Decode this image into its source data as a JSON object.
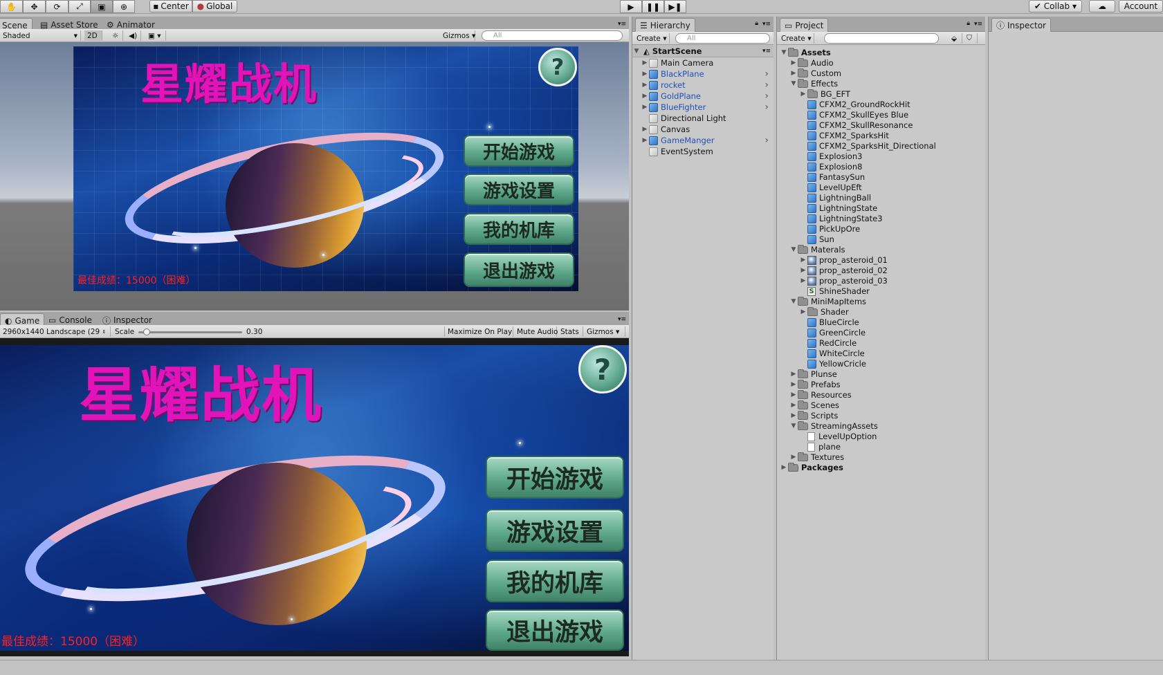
{
  "toolbar": {
    "pivot_label": "Center",
    "space_label": "Global",
    "collab_label": "Collab",
    "account_label": "Account",
    "tool_icons": [
      "hand-icon",
      "move-icon",
      "rotate-icon",
      "scale-icon",
      "rect-icon",
      "transform-icon"
    ]
  },
  "scene_view": {
    "tabs": [
      "Scene",
      "Asset Store",
      "Animator"
    ],
    "shading_mode": "Shaded",
    "mode_2d": "2D",
    "gizmos_label": "Gizmos",
    "search_placeholder": "All"
  },
  "game_view": {
    "tabs": [
      "Game",
      "Console",
      "Inspector"
    ],
    "resolution": "2960x1440 Landscape (29",
    "scale_label": "Scale",
    "scale_value": "0.30",
    "scale_fraction": 0.05,
    "buttons": [
      "Maximize On Play",
      "Mute Audio",
      "Stats",
      "Gizmos"
    ]
  },
  "game_ui": {
    "title": "星耀战机",
    "menu_buttons": [
      "开始游戏",
      "游戏设置",
      "我的机库",
      "退出游戏"
    ],
    "best_score": "最佳成绩：15000（困难）",
    "help_glyph": "?"
  },
  "hierarchy": {
    "tab": "Hierarchy",
    "create_label": "Create",
    "search_placeholder": "All",
    "scene_name": "StartScene",
    "items": [
      {
        "name": "Main Camera",
        "prefab": false,
        "expandable": true,
        "chevron": false
      },
      {
        "name": "BlackPlane",
        "prefab": true,
        "expandable": true,
        "chevron": true
      },
      {
        "name": "rocket",
        "prefab": true,
        "expandable": true,
        "chevron": true
      },
      {
        "name": "GoldPlane",
        "prefab": true,
        "expandable": true,
        "chevron": true
      },
      {
        "name": "BlueFighter",
        "prefab": true,
        "expandable": true,
        "chevron": true
      },
      {
        "name": "Directional Light",
        "prefab": false,
        "expandable": false,
        "chevron": false
      },
      {
        "name": "Canvas",
        "prefab": false,
        "expandable": true,
        "chevron": false
      },
      {
        "name": "GameManger",
        "prefab": true,
        "expandable": true,
        "chevron": true
      },
      {
        "name": "EventSystem",
        "prefab": false,
        "expandable": false,
        "chevron": false
      }
    ]
  },
  "project": {
    "tab": "Project",
    "create_label": "Create",
    "items": [
      {
        "name": "Assets",
        "depth": 0,
        "kind": "folder",
        "arrow": "open",
        "bold": true
      },
      {
        "name": "Audio",
        "depth": 1,
        "kind": "folder",
        "arrow": "closed"
      },
      {
        "name": "Custom",
        "depth": 1,
        "kind": "folder",
        "arrow": "closed"
      },
      {
        "name": "Effects",
        "depth": 1,
        "kind": "folder",
        "arrow": "open"
      },
      {
        "name": "BG_EFT",
        "depth": 2,
        "kind": "folder",
        "arrow": "closed"
      },
      {
        "name": "CFXM2_GroundRockHit",
        "depth": 2,
        "kind": "prefab",
        "arrow": "none"
      },
      {
        "name": "CFXM2_SkullEyes Blue",
        "depth": 2,
        "kind": "prefab",
        "arrow": "none"
      },
      {
        "name": "CFXM2_SkullResonance",
        "depth": 2,
        "kind": "prefab",
        "arrow": "none"
      },
      {
        "name": "CFXM2_SparksHit",
        "depth": 2,
        "kind": "prefab",
        "arrow": "none"
      },
      {
        "name": "CFXM2_SparksHit_Directional",
        "depth": 2,
        "kind": "prefab",
        "arrow": "none"
      },
      {
        "name": "Explosion3",
        "depth": 2,
        "kind": "prefab",
        "arrow": "none"
      },
      {
        "name": "Explosion8",
        "depth": 2,
        "kind": "prefab",
        "arrow": "none"
      },
      {
        "name": "FantasySun",
        "depth": 2,
        "kind": "prefab",
        "arrow": "none"
      },
      {
        "name": "LevelUpEft",
        "depth": 2,
        "kind": "prefab",
        "arrow": "none"
      },
      {
        "name": "LightningBall",
        "depth": 2,
        "kind": "prefab",
        "arrow": "none"
      },
      {
        "name": "LightningState",
        "depth": 2,
        "kind": "prefab",
        "arrow": "none"
      },
      {
        "name": "LightningState3",
        "depth": 2,
        "kind": "prefab",
        "arrow": "none"
      },
      {
        "name": "PickUpOre",
        "depth": 2,
        "kind": "prefab",
        "arrow": "none"
      },
      {
        "name": "Sun",
        "depth": 2,
        "kind": "prefab",
        "arrow": "none"
      },
      {
        "name": "Materals",
        "depth": 1,
        "kind": "folder",
        "arrow": "open"
      },
      {
        "name": "prop_asteroid_01",
        "depth": 2,
        "kind": "material",
        "arrow": "closed"
      },
      {
        "name": "prop_asteroid_02",
        "depth": 2,
        "kind": "material",
        "arrow": "closed"
      },
      {
        "name": "prop_asteroid_03",
        "depth": 2,
        "kind": "material",
        "arrow": "closed"
      },
      {
        "name": "ShineShader",
        "depth": 2,
        "kind": "shader",
        "arrow": "none"
      },
      {
        "name": "MiniMapItems",
        "depth": 1,
        "kind": "folder",
        "arrow": "open"
      },
      {
        "name": "Shader",
        "depth": 2,
        "kind": "folder",
        "arrow": "closed"
      },
      {
        "name": "BlueCircle",
        "depth": 2,
        "kind": "prefab",
        "arrow": "none"
      },
      {
        "name": "GreenCircle",
        "depth": 2,
        "kind": "prefab",
        "arrow": "none"
      },
      {
        "name": "RedCircle",
        "depth": 2,
        "kind": "prefab",
        "arrow": "none"
      },
      {
        "name": "WhiteCircle",
        "depth": 2,
        "kind": "prefab",
        "arrow": "none"
      },
      {
        "name": "YellowCricle",
        "depth": 2,
        "kind": "prefab",
        "arrow": "none"
      },
      {
        "name": "Plunse",
        "depth": 1,
        "kind": "folder",
        "arrow": "closed"
      },
      {
        "name": "Prefabs",
        "depth": 1,
        "kind": "folder",
        "arrow": "closed"
      },
      {
        "name": "Resources",
        "depth": 1,
        "kind": "folder",
        "arrow": "closed"
      },
      {
        "name": "Scenes",
        "depth": 1,
        "kind": "folder",
        "arrow": "closed"
      },
      {
        "name": "Scripts",
        "depth": 1,
        "kind": "folder",
        "arrow": "closed"
      },
      {
        "name": "StreamingAssets",
        "depth": 1,
        "kind": "folder",
        "arrow": "open"
      },
      {
        "name": "LevelUpOption",
        "depth": 2,
        "kind": "doc",
        "arrow": "none"
      },
      {
        "name": "plane",
        "depth": 2,
        "kind": "doc",
        "arrow": "none"
      },
      {
        "name": "Textures",
        "depth": 1,
        "kind": "folder",
        "arrow": "closed"
      },
      {
        "name": "Packages",
        "depth": 0,
        "kind": "folder",
        "arrow": "closed",
        "bold": true
      }
    ]
  },
  "inspector": {
    "tab": "Inspector"
  },
  "colors": {
    "prefab_text": "#1f4fb8",
    "title_magenta": "#e014b8",
    "score_red": "#ff2020"
  }
}
